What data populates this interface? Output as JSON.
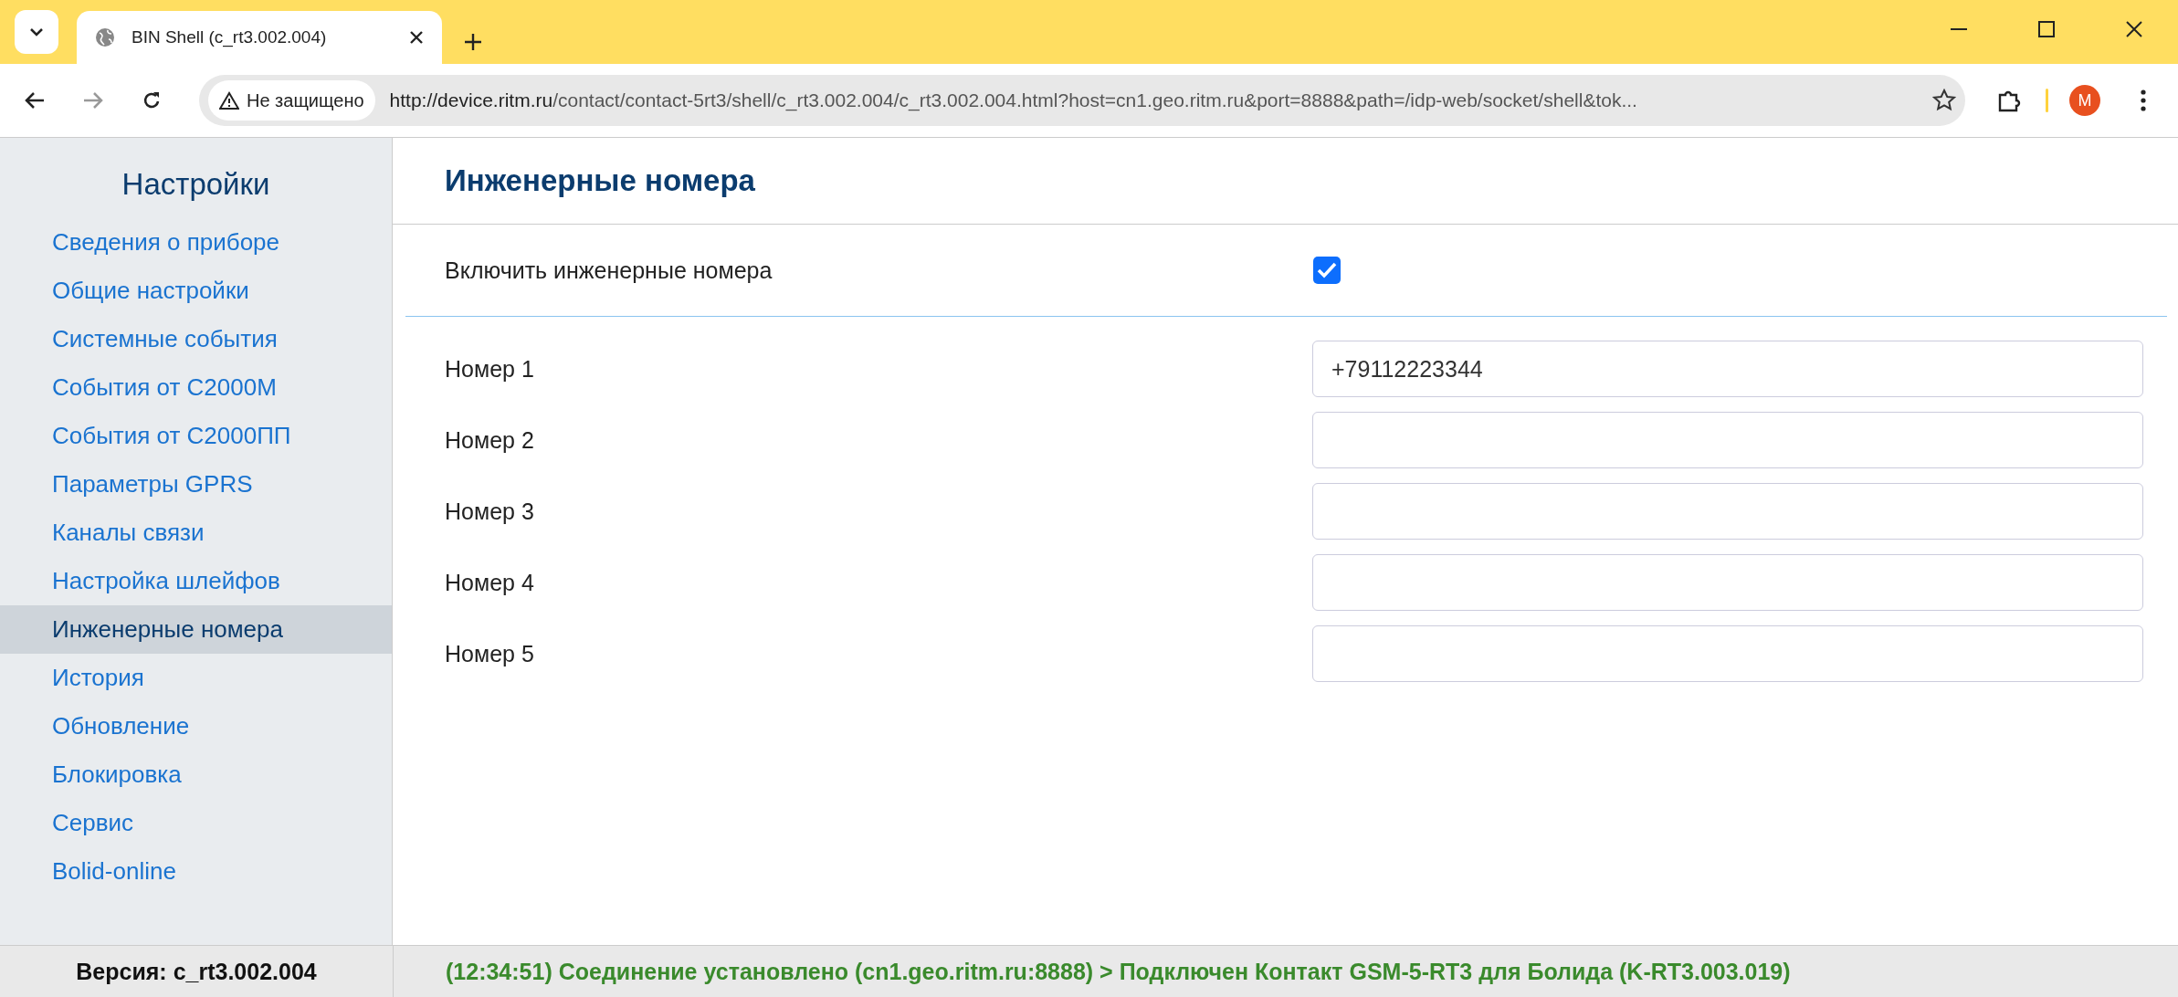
{
  "browser": {
    "tab_title": "BIN Shell (c_rt3.002.004)",
    "security_label": "Не защищено",
    "url_host": "http://device.ritm.ru",
    "url_path": "/contact/contact-5rt3/shell/c_rt3.002.004/c_rt3.002.004.html?host=cn1.geo.ritm.ru&port=8888&path=/idp-web/socket/shell&tok...",
    "profile_initial": "M"
  },
  "sidebar": {
    "title": "Настройки",
    "items": [
      {
        "label": "Сведения о приборе",
        "selected": false
      },
      {
        "label": "Общие настройки",
        "selected": false
      },
      {
        "label": "Системные события",
        "selected": false
      },
      {
        "label": "События от С2000М",
        "selected": false
      },
      {
        "label": "События от С2000ПП",
        "selected": false
      },
      {
        "label": "Параметры GPRS",
        "selected": false
      },
      {
        "label": "Каналы связи",
        "selected": false
      },
      {
        "label": "Настройка шлейфов",
        "selected": false
      },
      {
        "label": "Инженерные номера",
        "selected": true
      },
      {
        "label": "История",
        "selected": false
      },
      {
        "label": "Обновление",
        "selected": false
      },
      {
        "label": "Блокировка",
        "selected": false
      },
      {
        "label": "Сервис",
        "selected": false
      },
      {
        "label": "Bolid-online",
        "selected": false
      }
    ]
  },
  "content": {
    "title": "Инженерные номера",
    "enable": {
      "label": "Включить инженерные номера",
      "checked": true
    },
    "numbers": [
      {
        "label": "Номер 1",
        "value": "+79112223344"
      },
      {
        "label": "Номер 2"
      },
      {
        "label": "Номер 3"
      },
      {
        "label": "Номер 4"
      },
      {
        "label": "Номер 5"
      }
    ]
  },
  "status_bar": {
    "version": "Версия: c_rt3.002.004",
    "message": "(12:34:51) Соединение установлено (cn1.geo.ritm.ru:8888) > Подключен Контакт GSM-5-RT3 для Болида (K-RT3.003.019)"
  }
}
